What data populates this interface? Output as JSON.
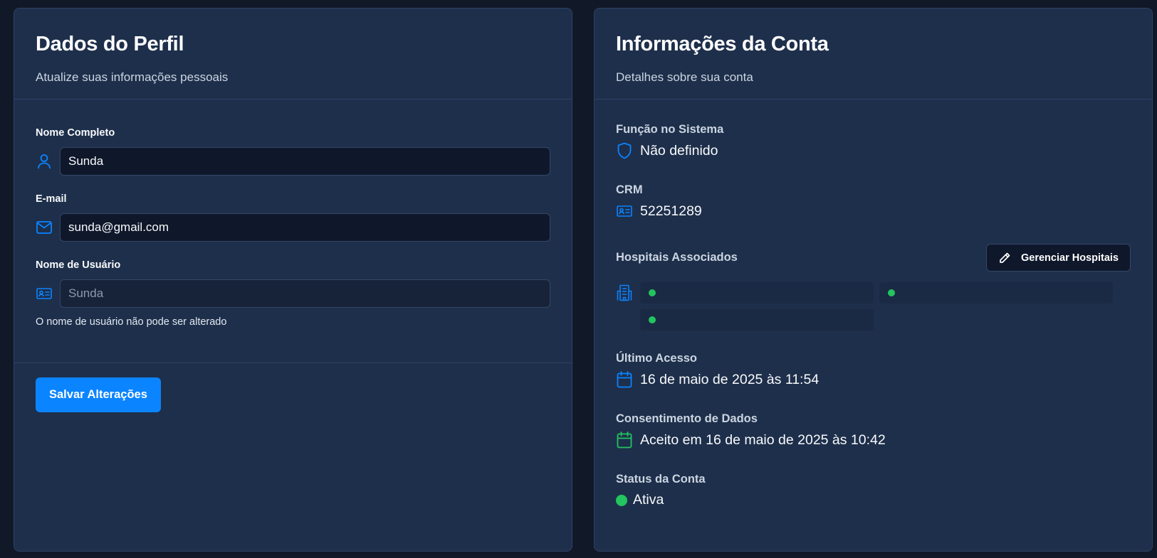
{
  "profile": {
    "title": "Dados do Perfil",
    "subtitle": "Atualize suas informações pessoais",
    "fields": {
      "full_name": {
        "label": "Nome Completo",
        "value": "Sunda",
        "icon": "user-icon"
      },
      "email": {
        "label": "E-mail",
        "value": "sunda@gmail.com",
        "icon": "mail-icon"
      },
      "username": {
        "label": "Nome de Usuário",
        "value": "Sunda",
        "icon": "id-card-icon",
        "disabled": true,
        "helper": "O nome de usuário não pode ser alterado"
      }
    },
    "save_label": "Salvar Alterações"
  },
  "account": {
    "title": "Informações da Conta",
    "subtitle": "Detalhes sobre sua conta",
    "role": {
      "label": "Função no Sistema",
      "value": "Não definido",
      "icon": "shield-icon"
    },
    "crm": {
      "label": "CRM",
      "value": "52251289",
      "icon": "id-card-icon"
    },
    "hospitals": {
      "label": "Hospitais Associados",
      "manage_label": "Gerenciar Hospitais",
      "icon": "building-icon",
      "items": [
        "",
        "",
        ""
      ]
    },
    "last_access": {
      "label": "Último Acesso",
      "value": "16 de maio de 2025 às 11:54",
      "icon": "calendar-icon"
    },
    "consent": {
      "label": "Consentimento de Dados",
      "value": "Aceito em 16 de maio de 2025 às 10:42",
      "icon": "calendar-check-icon"
    },
    "status": {
      "label": "Status da Conta",
      "value": "Ativa"
    }
  },
  "colors": {
    "background": "#111827",
    "card": "#1e2f4b",
    "accent": "#0a84ff",
    "success": "#22c55e"
  }
}
